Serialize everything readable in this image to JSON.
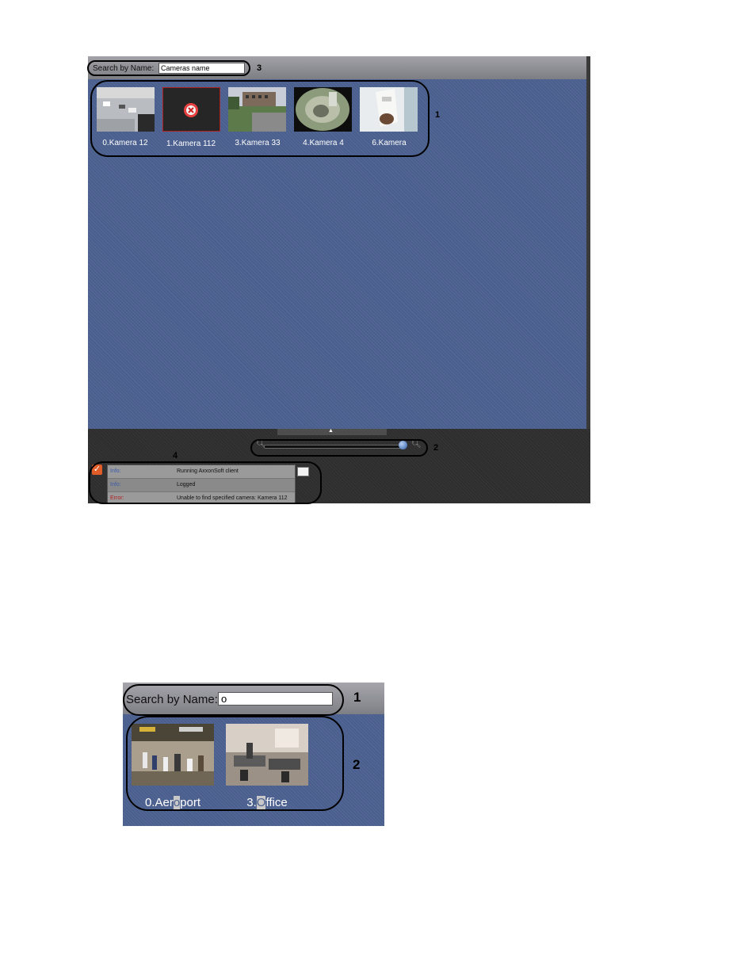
{
  "screenshot1": {
    "search": {
      "label": "Search by Name:",
      "value": "Cameras name"
    },
    "cameras": [
      {
        "label": "0.Kamera 12"
      },
      {
        "label": "1.Kamera 112"
      },
      {
        "label": "3.Kamera 33"
      },
      {
        "label": "4.Kamera 4"
      },
      {
        "label": "6.Kamera"
      }
    ],
    "log": [
      {
        "type": "Info:",
        "message": "Running AxxonSoft client",
        "color": "#3b5aa8"
      },
      {
        "type": "Info:",
        "message": "Logged",
        "color": "#3b5aa8"
      },
      {
        "type": "Error:",
        "message": "Unable to find specified camera: Kamera 112",
        "color": "#b22222"
      }
    ],
    "callouts": [
      "1",
      "2",
      "3",
      "4"
    ]
  },
  "screenshot2": {
    "search": {
      "label": "Search by Name:",
      "value": "o"
    },
    "cameras": [
      {
        "before": "0.Aer",
        "highlight": "o",
        "after": "port"
      },
      {
        "before": "3.",
        "highlight": "O",
        "after": "ffice"
      }
    ],
    "callouts": [
      "1",
      "2"
    ]
  }
}
